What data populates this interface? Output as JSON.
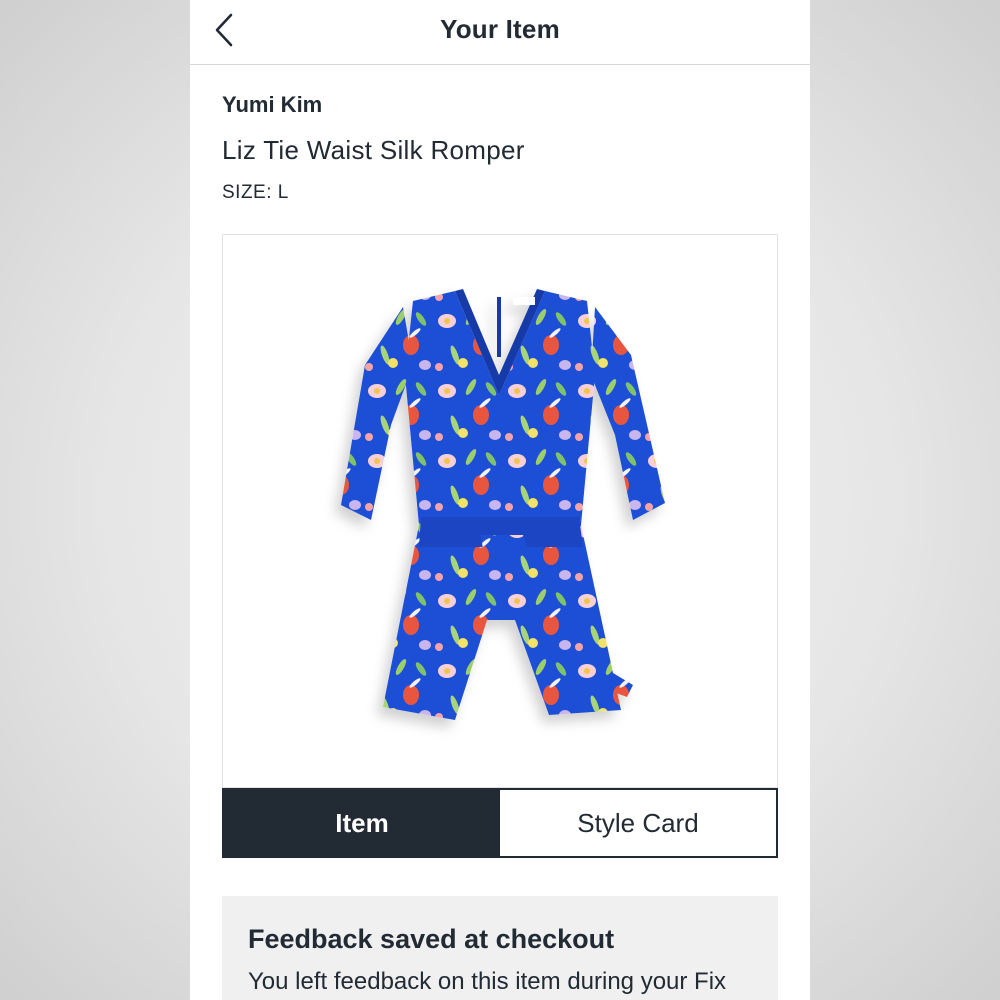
{
  "header": {
    "title": "Your Item",
    "back_icon": "chevron-left-icon"
  },
  "product": {
    "brand": "Yumi Kim",
    "name": "Liz Tie Waist Silk Romper",
    "size": "SIZE: L",
    "image": "floral-romper-image",
    "colors": {
      "fabric": "#1f4fd6",
      "accent_pink": "#f4a3a8",
      "accent_coral": "#e8563f",
      "accent_leaf": "#9ccf6a"
    }
  },
  "tabs": {
    "items": [
      "Item",
      "Style Card"
    ],
    "selected": "Item"
  },
  "feedback": {
    "title": "Feedback saved at checkout",
    "body": "You left feedback on this item during your Fix"
  },
  "theme": {
    "dark": "#222a33",
    "card_bg": "#f0f0f1",
    "divider": "#d7d7d7"
  }
}
